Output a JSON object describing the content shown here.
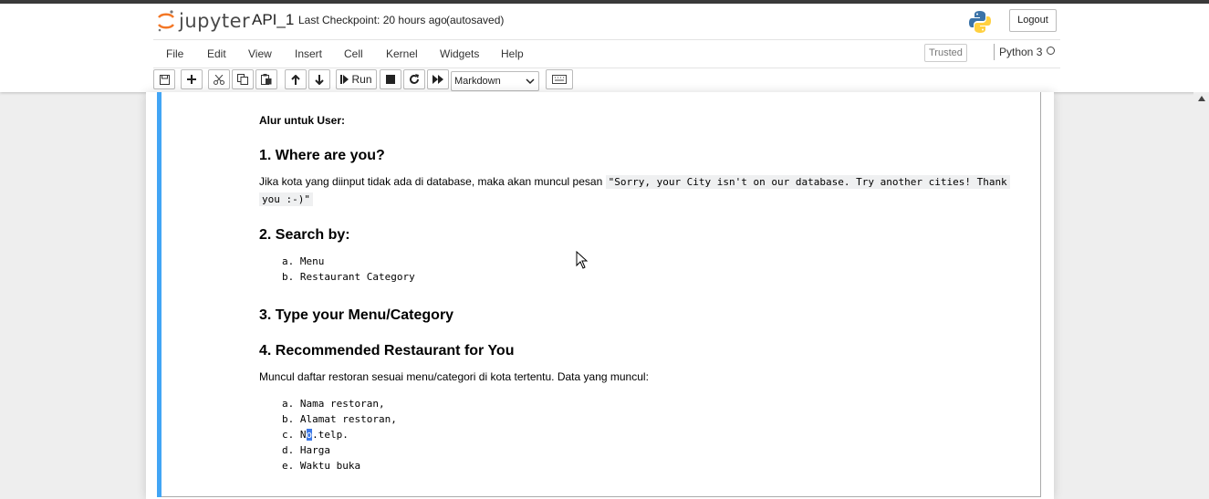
{
  "header": {
    "logo_text": "jupyter",
    "notebook_name": "API_1",
    "checkpoint": "Last Checkpoint: 20 hours ago",
    "autosave": "(autosaved)",
    "logout_label": "Logout"
  },
  "menu": {
    "items": [
      "File",
      "Edit",
      "View",
      "Insert",
      "Cell",
      "Kernel",
      "Widgets",
      "Help"
    ],
    "trusted_label": "Trusted",
    "kernel_name": "Python 3"
  },
  "toolbar": {
    "run_label": "Run",
    "cell_type": "Markdown"
  },
  "content": {
    "intro": "Alur untuk User:",
    "sec1_title": "1. Where are you?",
    "sec1_text": "Jika kota yang diinput tidak ada di database, maka akan muncul pesan",
    "sec1_code_line1": "\"Sorry, your City isn't on our database. Try another cities! Thank",
    "sec1_code_line2": "you :-)\"",
    "sec2_title": "2. Search by:",
    "sec2_items": [
      "a. Menu",
      "b. Restaurant Category"
    ],
    "sec3_title": "3. Type your Menu/Category",
    "sec4_title": "4. Recommended Restaurant for You",
    "sec4_text": "Muncul daftar restoran sesuai menu/categori di kota tertentu. Data yang muncul:",
    "sec4_items": [
      "a. Nama restoran,",
      "b. Alamat restoran,",
      "c. No.telp.",
      "d. Harga",
      "e. Waktu buka"
    ],
    "sec4_item3_prefix": "c. N",
    "sec4_item3_selected": "o",
    "sec4_item3_suffix": ".telp."
  },
  "colors": {
    "cell_selected_bar": "#42a5f5",
    "text_selection": "#3b78e7",
    "jupyter_orange": "#f37726"
  }
}
